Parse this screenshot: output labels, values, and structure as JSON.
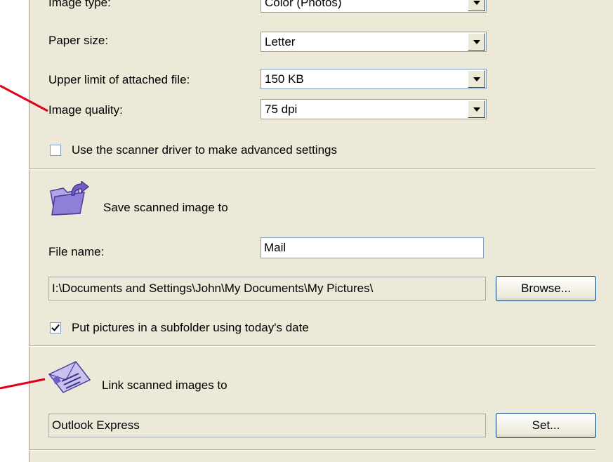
{
  "image_settings": {
    "image_type_label": "Image type:",
    "image_type_value": "Color (Photos)",
    "paper_size_label": "Paper size:",
    "paper_size_value": "Letter",
    "upper_limit_label": "Upper limit of attached file:",
    "upper_limit_value": "150 KB",
    "image_quality_label": "Image quality:",
    "image_quality_value": "75 dpi",
    "advanced_checkbox_label": "Use the scanner driver to make advanced settings",
    "advanced_checked": false
  },
  "save_section": {
    "icon": "folder-arrow-icon",
    "heading": "Save scanned image to",
    "file_name_label": "File name:",
    "file_name_value": "Mail",
    "path_value": "I:\\Documents and Settings\\John\\My Documents\\My Pictures\\",
    "browse_label": "Browse...",
    "subfolder_label": "Put pictures in a subfolder using today's date",
    "subfolder_checked": true
  },
  "link_section": {
    "icon": "email-envelope-icon",
    "heading": "Link scanned images to",
    "program_value": "Outlook Express",
    "set_label": "Set..."
  },
  "colors": {
    "panel": "#ece9d8",
    "annotation": "#e0001b",
    "border": "#7f9db9"
  }
}
